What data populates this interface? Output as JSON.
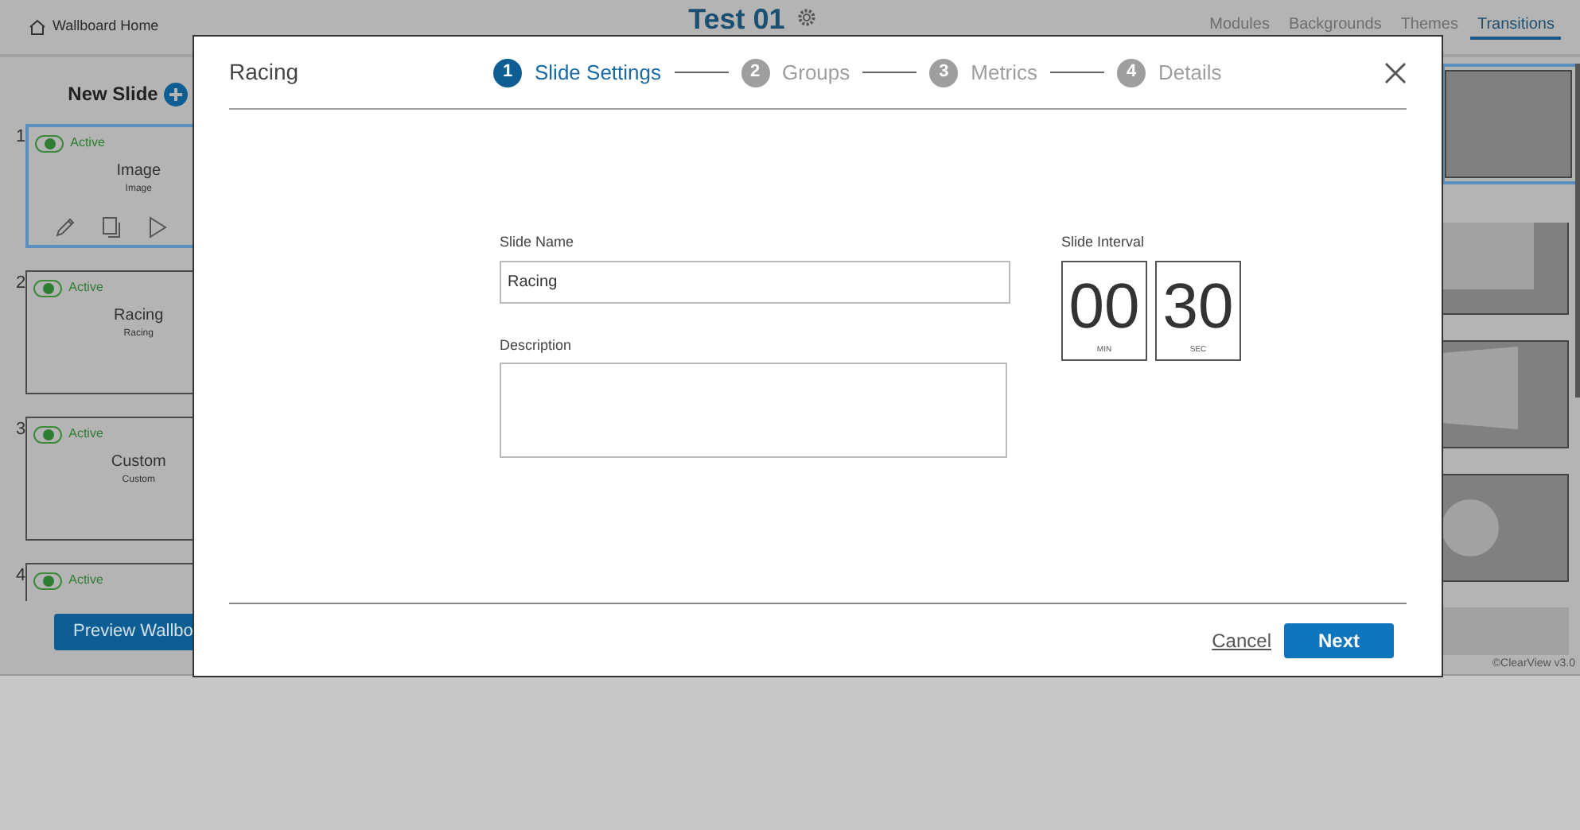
{
  "header": {
    "home_link": "Wallboard Home",
    "title": "Test 01",
    "tabs": [
      {
        "label": "Modules",
        "selected": false
      },
      {
        "label": "Backgrounds",
        "selected": false
      },
      {
        "label": "Themes",
        "selected": false
      },
      {
        "label": "Transitions",
        "selected": true
      }
    ]
  },
  "sidebar": {
    "new_slide": "New Slide",
    "slides": [
      {
        "number": "1",
        "active": true,
        "status": "Active",
        "title": "Image",
        "subtitle": "Image",
        "selected": true
      },
      {
        "number": "2",
        "active": true,
        "status": "Active",
        "title": "Racing",
        "subtitle": "Racing",
        "selected": false
      },
      {
        "number": "3",
        "active": true,
        "status": "Active",
        "title": "Custom",
        "subtitle": "Custom",
        "selected": false
      },
      {
        "number": "4",
        "active": true,
        "status": "Active",
        "selected": false
      }
    ],
    "preview_button": "Preview Wallbo"
  },
  "transitions": [
    {
      "kind": "plain",
      "selected": true
    },
    {
      "kind": "slide",
      "selected": false
    },
    {
      "kind": "perspective",
      "selected": false
    },
    {
      "kind": "circle",
      "selected": false
    },
    {
      "kind": "fade",
      "selected": false
    }
  ],
  "copyright": "©ClearView v3.0",
  "modal": {
    "title": "Racing",
    "steps": [
      {
        "number": "1",
        "label": "Slide Settings",
        "selected": true
      },
      {
        "number": "2",
        "label": "Groups",
        "selected": false
      },
      {
        "number": "3",
        "label": "Metrics",
        "selected": false
      },
      {
        "number": "4",
        "label": "Details",
        "selected": false
      }
    ],
    "slide_name": {
      "label": "Slide Name",
      "value": "Racing"
    },
    "description": {
      "label": "Description"
    },
    "interval": {
      "label": "Slide Interval",
      "minutes": "00",
      "minutes_label": "MIN",
      "seconds": "30",
      "seconds_label": "SEC"
    },
    "cancel": "Cancel",
    "next": "Next"
  }
}
